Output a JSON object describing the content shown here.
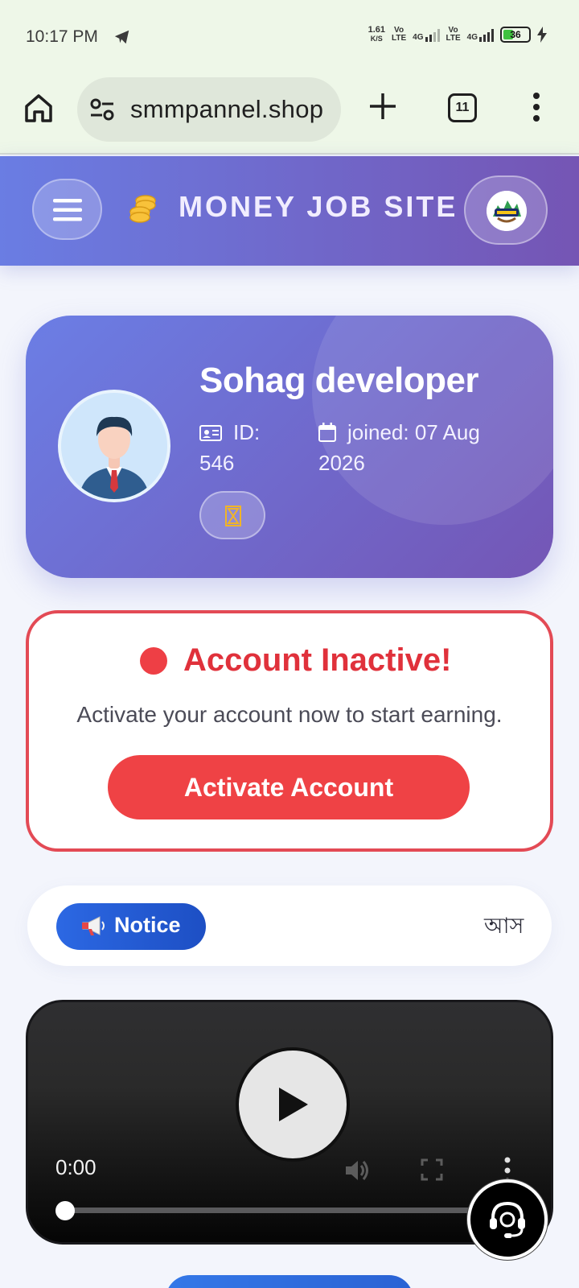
{
  "status_bar": {
    "time": "10:17 PM",
    "net_speed_value": "1.61",
    "net_speed_unit": "K/S",
    "sim1_top": "Vo",
    "sim1_bottom": "LTE",
    "sim1_net": "4G",
    "sim2_top": "Vo",
    "sim2_bottom": "LTE",
    "sim2_net": "4G",
    "battery_level": "36"
  },
  "browser": {
    "url": "smmpannel.shop",
    "tab_count": "11"
  },
  "header": {
    "brand": "MONEY JOB SITE"
  },
  "profile": {
    "name": "Sohag developer",
    "id_label": "ID:",
    "id_value": "546",
    "joined_text": "joined: 07 Aug 2026"
  },
  "inactive_notice": {
    "title": "Account Inactive!",
    "description": "Activate your account now to start earning.",
    "button_label": "Activate Account"
  },
  "notice": {
    "label": "Notice",
    "marquee_text": "আস"
  },
  "video": {
    "time": "0:00",
    "progress": 0
  },
  "colors": {
    "header_gradient_start": "#6a7de3",
    "header_gradient_end": "#7555b4",
    "danger": "#ef4245",
    "notice_blue": "#2c68e3",
    "status_bar_bg": "#eef7e8"
  },
  "icons": {
    "telegram": "telegram-icon",
    "home": "home-icon",
    "site_settings": "tune-icon",
    "new_tab": "plus-icon",
    "menu": "menu-dots-icon",
    "hamburger": "hamburger-icon",
    "coins": "coins-icon",
    "id_card": "id-card-icon",
    "calendar": "calendar-icon",
    "hourglass": "hourglass-icon",
    "megaphone": "megaphone-icon",
    "play": "play-icon",
    "volume": "volume-icon",
    "fullscreen": "fullscreen-icon",
    "support": "headset-icon"
  }
}
